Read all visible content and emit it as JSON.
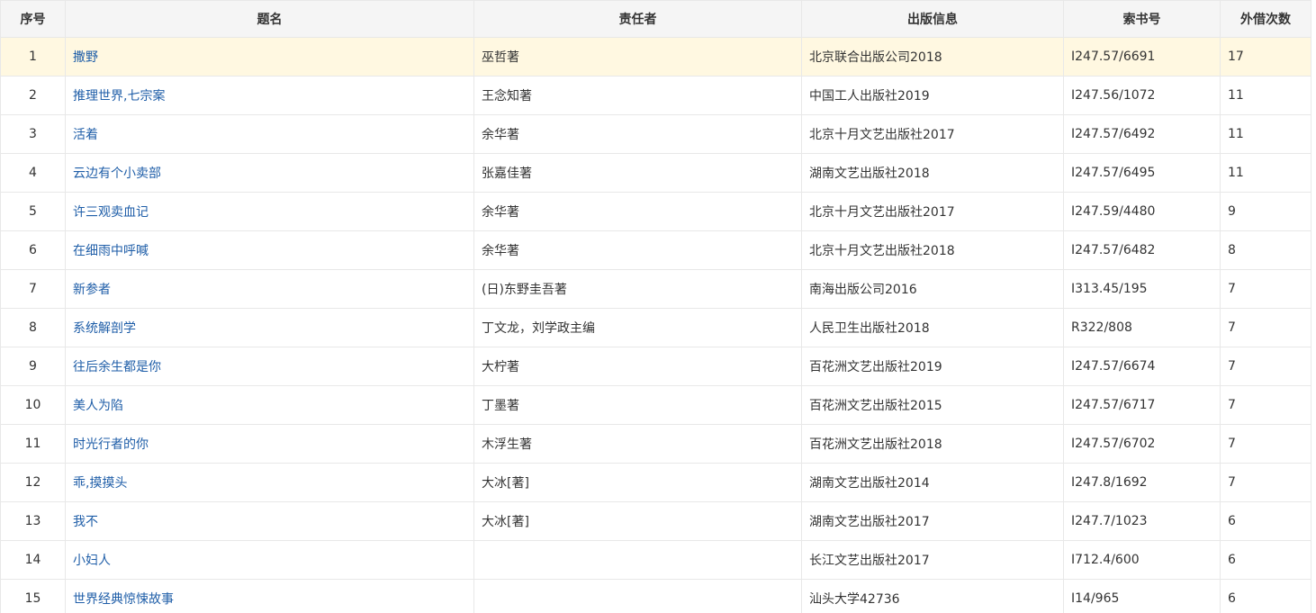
{
  "table": {
    "headers": {
      "seq": "序号",
      "title": "题名",
      "author": "责任者",
      "publication": "出版信息",
      "call_number": "索书号",
      "loans": "外借次数"
    },
    "rows": [
      {
        "seq": "1",
        "title": "撒野",
        "author": "巫哲著",
        "publication": "北京联合出版公司2018",
        "call_number": "I247.57/6691",
        "loans": "17"
      },
      {
        "seq": "2",
        "title": "推理世界,七宗案",
        "author": "王念知著",
        "publication": "中国工人出版社2019",
        "call_number": "I247.56/1072",
        "loans": "11"
      },
      {
        "seq": "3",
        "title": "活着",
        "author": "余华著",
        "publication": "北京十月文艺出版社2017",
        "call_number": "I247.57/6492",
        "loans": "11"
      },
      {
        "seq": "4",
        "title": "云边有个小卖部",
        "author": "张嘉佳著",
        "publication": "湖南文艺出版社2018",
        "call_number": "I247.57/6495",
        "loans": "11"
      },
      {
        "seq": "5",
        "title": "许三观卖血记",
        "author": "余华著",
        "publication": "北京十月文艺出版社2017",
        "call_number": "I247.59/4480",
        "loans": "9"
      },
      {
        "seq": "6",
        "title": "在细雨中呼喊",
        "author": "余华著",
        "publication": "北京十月文艺出版社2018",
        "call_number": "I247.57/6482",
        "loans": "8"
      },
      {
        "seq": "7",
        "title": "新参者",
        "author": "(日)东野圭吾著",
        "publication": "南海出版公司2016",
        "call_number": "I313.45/195",
        "loans": "7"
      },
      {
        "seq": "8",
        "title": "系统解剖学",
        "author": "丁文龙，刘学政主编",
        "publication": "人民卫生出版社2018",
        "call_number": "R322/808",
        "loans": "7"
      },
      {
        "seq": "9",
        "title": "往后余生都是你",
        "author": "大柠著",
        "publication": "百花洲文艺出版社2019",
        "call_number": "I247.57/6674",
        "loans": "7"
      },
      {
        "seq": "10",
        "title": "美人为陷",
        "author": "丁墨著",
        "publication": "百花洲文艺出版社2015",
        "call_number": "I247.57/6717",
        "loans": "7"
      },
      {
        "seq": "11",
        "title": "时光行者的你",
        "author": "木浮生著",
        "publication": "百花洲文艺出版社2018",
        "call_number": "I247.57/6702",
        "loans": "7"
      },
      {
        "seq": "12",
        "title": "乖,摸摸头",
        "author": "大冰[著]",
        "publication": "湖南文艺出版社2014",
        "call_number": "I247.8/1692",
        "loans": "7"
      },
      {
        "seq": "13",
        "title": "我不",
        "author": "大冰[著]",
        "publication": "湖南文艺出版社2017",
        "call_number": "I247.7/1023",
        "loans": "6"
      },
      {
        "seq": "14",
        "title": "小妇人",
        "author": "",
        "publication": "长江文艺出版社2017",
        "call_number": "I712.4/600",
        "loans": "6"
      },
      {
        "seq": "15",
        "title": "世界经典惊悚故事",
        "author": "",
        "publication": "汕头大学42736",
        "call_number": "I14/965",
        "loans": "6"
      }
    ]
  },
  "colors": {
    "link": "#1f5ea8",
    "highlight_row": "#fff8e1",
    "header_bg": "#f5f5f5",
    "border": "#e8e8e8"
  }
}
